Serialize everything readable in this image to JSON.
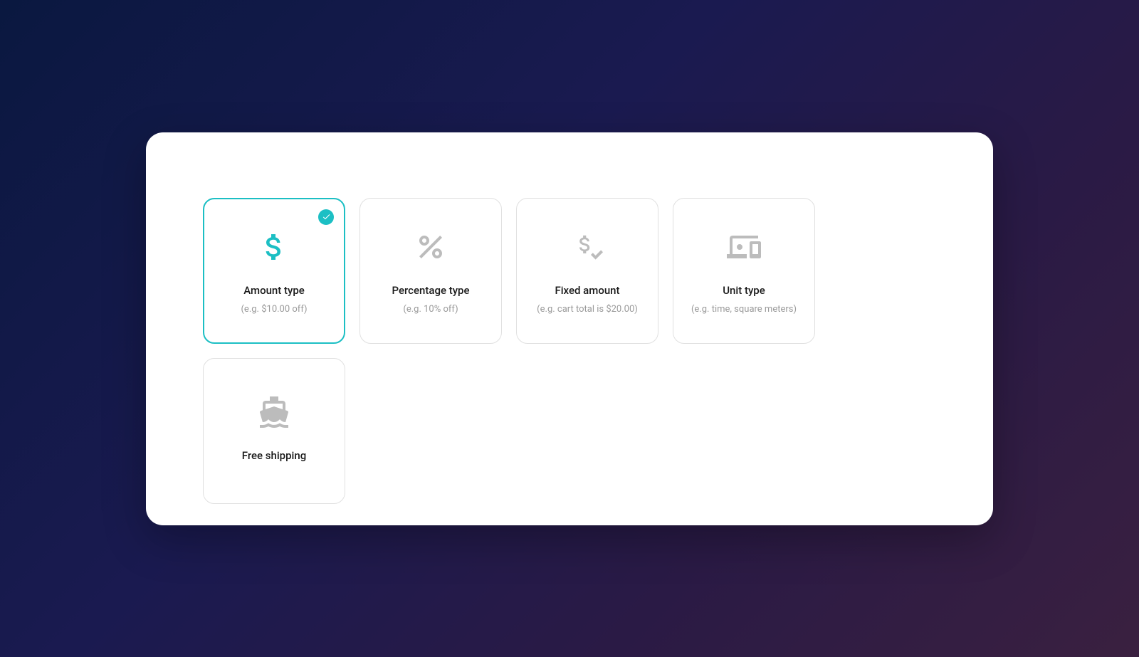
{
  "options": [
    {
      "id": "amount",
      "title": "Amount type",
      "subtitle": "(e.g. $10.00 off)",
      "selected": true,
      "icon": "dollar-icon"
    },
    {
      "id": "percentage",
      "title": "Percentage type",
      "subtitle": "(e.g. 10% off)",
      "selected": false,
      "icon": "percent-icon"
    },
    {
      "id": "fixed",
      "title": "Fixed amount",
      "subtitle": "(e.g. cart total is $20.00)",
      "selected": false,
      "icon": "dollar-check-icon"
    },
    {
      "id": "unit",
      "title": "Unit type",
      "subtitle": "(e.g. time, square meters)",
      "selected": false,
      "icon": "devices-icon"
    },
    {
      "id": "shipping",
      "title": "Free shipping",
      "subtitle": "",
      "selected": false,
      "icon": "ship-icon"
    }
  ],
  "colors": {
    "accent": "#1cbfc4",
    "muted": "#bcbcbc",
    "border": "#e0e0e0"
  }
}
